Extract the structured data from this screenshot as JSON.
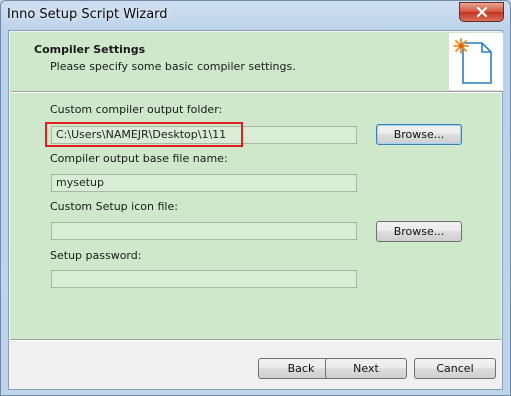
{
  "window": {
    "title": "Inno Setup Script Wizard"
  },
  "header": {
    "title": "Compiler Settings",
    "subtitle": "Please specify some basic compiler settings.",
    "image_icon": "document-star-icon"
  },
  "form": {
    "output_folder": {
      "label": "Custom compiler output folder:",
      "value": "C:\\Users\\NAMEJR\\Desktop\\1\\11",
      "browse_label": "Browse..."
    },
    "base_file_name": {
      "label": "Compiler output base file name:",
      "value": "mysetup"
    },
    "icon_file": {
      "label": "Custom Setup icon file:",
      "value": "",
      "browse_label": "Browse..."
    },
    "password": {
      "label": "Setup password:",
      "value": ""
    }
  },
  "footer": {
    "back_label": "Back",
    "next_label": "Next",
    "cancel_label": "Cancel"
  },
  "colors": {
    "content_bg": "#cfe8cc",
    "highlight": "#e02020",
    "close_button": "#d4523d"
  }
}
